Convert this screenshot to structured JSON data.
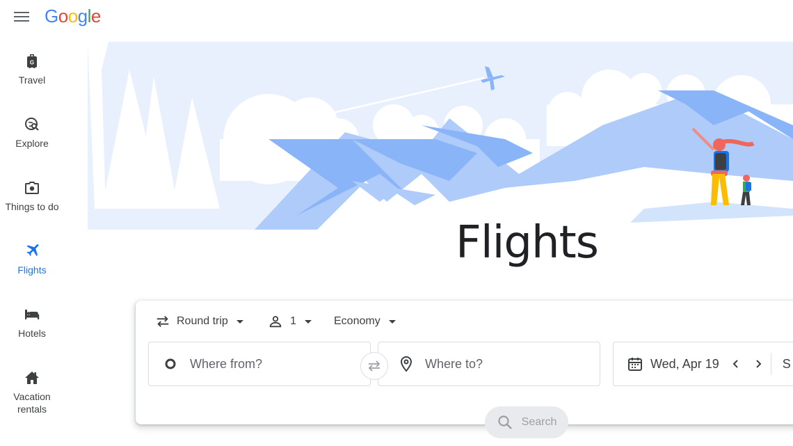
{
  "header": {
    "logo_letters": [
      {
        "ch": "G",
        "color": "#4285F4"
      },
      {
        "ch": "o",
        "color": "#EA4335"
      },
      {
        "ch": "o",
        "color": "#FBBC05"
      },
      {
        "ch": "g",
        "color": "#4285F4"
      },
      {
        "ch": "l",
        "color": "#34A853"
      },
      {
        "ch": "e",
        "color": "#EA4335"
      }
    ]
  },
  "sidebar": {
    "items": [
      {
        "label": "Travel",
        "icon": "luggage-icon"
      },
      {
        "label": "Explore",
        "icon": "explore-icon"
      },
      {
        "label": "Things to do",
        "icon": "camera-icon"
      },
      {
        "label": "Flights",
        "icon": "airplane-icon",
        "active": true
      },
      {
        "label": "Hotels",
        "icon": "bed-icon"
      },
      {
        "label": "Vacation rentals",
        "icon": "house-icon"
      }
    ]
  },
  "hero": {
    "title": "Flights"
  },
  "search": {
    "trip_type": "Round trip",
    "passengers": "1",
    "cabin_class": "Economy",
    "from_placeholder": "Where from?",
    "to_placeholder": "Where to?",
    "depart_date": "Wed, Apr 19",
    "return_date_partial": "S",
    "search_label": "Search"
  },
  "colors": {
    "accent": "#1a73e8",
    "text": "#202124",
    "muted": "#5f6368",
    "hero_blue": "#aecbfa",
    "hero_light": "#e8f0fe"
  }
}
